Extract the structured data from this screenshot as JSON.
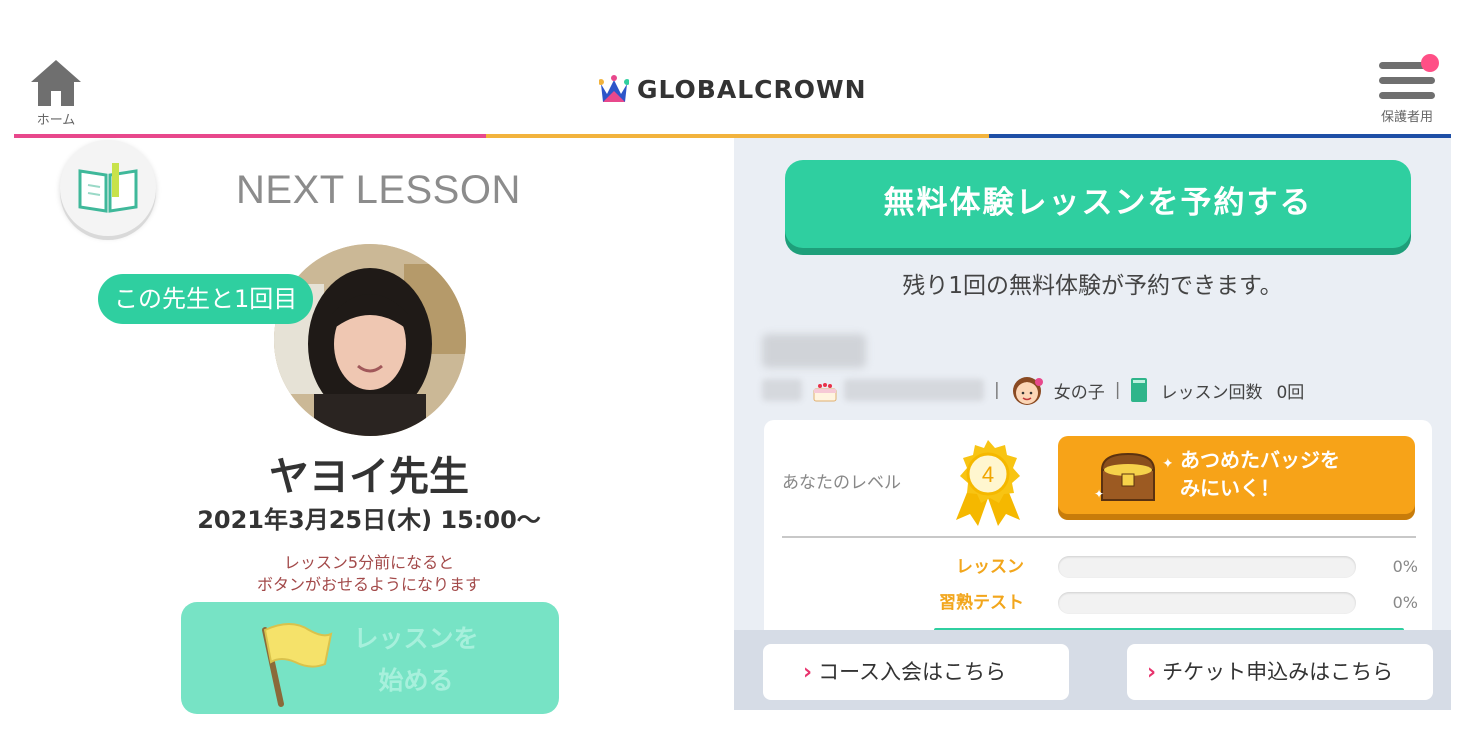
{
  "header": {
    "home_label": "ホーム",
    "logo_text": "GLOBALCROWN",
    "menu_label": "保護者用",
    "stripe_colors": [
      "#e8488c",
      "#f2b33d",
      "#1e4fa6"
    ]
  },
  "next_lesson": {
    "heading": "NEXT LESSON",
    "count_badge": "この先生と1回目",
    "teacher_name": "ヤヨイ先生",
    "datetime": "2021年3月25日(木) 15:00〜",
    "note_line1": "レッスン5分前になると",
    "note_line2": "ボタンがおせるようになります",
    "start_button_line1": "レッスンを",
    "start_button_line2": "始める"
  },
  "trial": {
    "button_label": "無料体験レッスンを予約する",
    "note": "残り1回の無料体験が予約できます。"
  },
  "profile": {
    "gender": "女の子",
    "lesson_count_label": "レッスン回数",
    "lesson_count_value": "0回",
    "level_label": "あなたのレベル",
    "level_value": "4",
    "badges_line1": "あつめたバッジを",
    "badges_line2": "みにいく！"
  },
  "progress": [
    {
      "label": "レッスン",
      "value": 0,
      "display": "0%"
    },
    {
      "label": "習熟テスト",
      "value": 0,
      "display": "0%"
    }
  ],
  "links": {
    "course": "コース入会はこちら",
    "ticket": "チケット申込みはこちら"
  },
  "colors": {
    "accent_green": "#2fcfa0",
    "accent_orange": "#f7a318",
    "accent_pink": "#e8336d"
  }
}
